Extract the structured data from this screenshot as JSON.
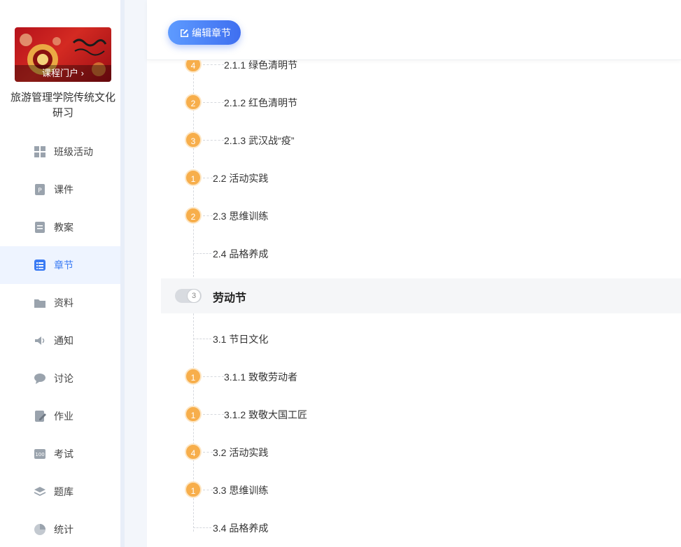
{
  "sidebar": {
    "banner_label": "课程门户",
    "course_title": "旅游管理学院传统文化研习",
    "items": [
      {
        "label": "班级活动",
        "icon": "grid-icon"
      },
      {
        "label": "课件",
        "icon": "ppt-file-icon"
      },
      {
        "label": "教案",
        "icon": "lesson-plan-icon"
      },
      {
        "label": "章节",
        "icon": "list-icon",
        "active": true
      },
      {
        "label": "资料",
        "icon": "folder-icon"
      },
      {
        "label": "通知",
        "icon": "speaker-icon"
      },
      {
        "label": "讨论",
        "icon": "chat-icon"
      },
      {
        "label": "作业",
        "icon": "edit-doc-icon"
      },
      {
        "label": "考试",
        "icon": "exam-icon"
      },
      {
        "label": "题库",
        "icon": "layers-icon"
      },
      {
        "label": "统计",
        "icon": "pie-chart-icon"
      }
    ]
  },
  "toolbar": {
    "edit_label": "编辑章节"
  },
  "sections": [
    {
      "badge": "4",
      "label": "2.1.1 绿色清明节"
    },
    {
      "badge": "2",
      "label": "2.1.2 红色清明节"
    },
    {
      "badge": "3",
      "label": "2.1.3 武汉战“疫”"
    },
    {
      "badge": "1",
      "label": "2.2 活动实践"
    },
    {
      "badge": "2",
      "label": "2.3 思维训练"
    },
    {
      "badge": "",
      "label": "2.4 品格养成"
    }
  ],
  "chapter": {
    "number": "3",
    "title": "劳动节"
  },
  "sections2": [
    {
      "badge": "",
      "label": "3.1 节日文化"
    },
    {
      "badge": "1",
      "label": "3.1.1 致敬劳动者"
    },
    {
      "badge": "1",
      "label": "3.1.2 致敬大国工匠"
    },
    {
      "badge": "4",
      "label": "3.2 活动实践"
    },
    {
      "badge": "1",
      "label": "3.3 思维训练"
    },
    {
      "badge": "",
      "label": "3.4 品格养成"
    }
  ],
  "colors": {
    "accent": "#3a7bf4",
    "badge": "#f7ae4b"
  }
}
